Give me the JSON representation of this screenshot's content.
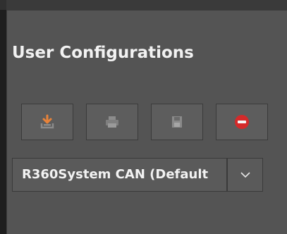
{
  "panel": {
    "title": "User Configurations"
  },
  "toolbar": {
    "buttons": [
      {
        "name": "import-configuration",
        "icon": "download-tray-icon",
        "icon_color": "#e8833a"
      },
      {
        "name": "print-configuration",
        "icon": "printer-icon"
      },
      {
        "name": "save-configuration",
        "icon": "floppy-disk-icon"
      },
      {
        "name": "delete-configuration",
        "icon": "minus-circle-icon",
        "icon_color": "#d42a2a"
      }
    ]
  },
  "configuration_select": {
    "selected": "R360System CAN (Default"
  },
  "colors": {
    "panel_background": "#545454",
    "text": "#f2f2f2",
    "accent_orange": "#e8833a",
    "danger_red": "#d42a2a"
  }
}
